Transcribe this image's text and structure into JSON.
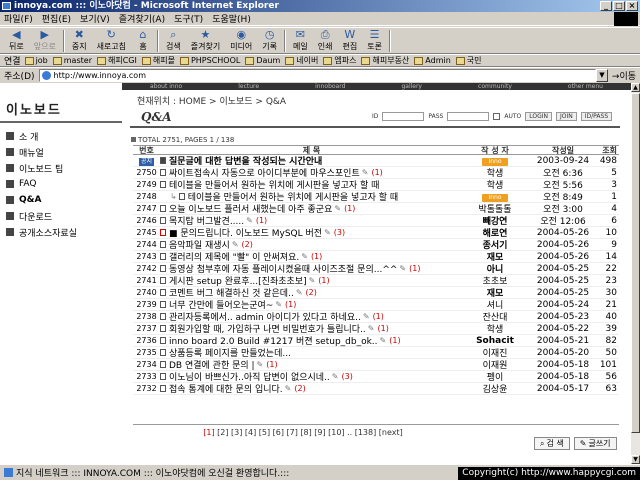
{
  "window": {
    "title": "innoya.com ::: 이노야닷컴 - Microsoft Internet Explorer"
  },
  "menu": [
    "파일(F)",
    "편집(E)",
    "보기(V)",
    "즐겨찾기(A)",
    "도구(T)",
    "도움말(H)"
  ],
  "toolbar": [
    {
      "label": "뒤로",
      "icon": "back-arrow-icon",
      "glyph": "◀"
    },
    {
      "label": "앞으로",
      "icon": "forward-arrow-icon",
      "glyph": "▶",
      "disabled": true
    },
    {
      "label": "중지",
      "icon": "stop-icon",
      "glyph": "✖"
    },
    {
      "label": "새로고침",
      "icon": "refresh-icon",
      "glyph": "↻"
    },
    {
      "label": "홈",
      "icon": "home-icon",
      "glyph": "⌂"
    },
    {
      "label": "검색",
      "icon": "search-icon",
      "glyph": "⌕"
    },
    {
      "label": "즐겨찾기",
      "icon": "favorites-icon",
      "glyph": "★"
    },
    {
      "label": "미디어",
      "icon": "media-icon",
      "glyph": "◉"
    },
    {
      "label": "기록",
      "icon": "history-icon",
      "glyph": "◷"
    },
    {
      "label": "메일",
      "icon": "mail-icon",
      "glyph": "✉"
    },
    {
      "label": "인쇄",
      "icon": "print-icon",
      "glyph": "⎙"
    },
    {
      "label": "편집",
      "icon": "edit-icon",
      "glyph": "W"
    },
    {
      "label": "토론",
      "icon": "discuss-icon",
      "glyph": "☰"
    }
  ],
  "links": {
    "label": "연결",
    "items": [
      "job",
      "master",
      "해피CGI",
      "해피몰",
      "PHPSCHOOL",
      "Daum",
      "네이버",
      "엠파스",
      "해피부동산",
      "Admin",
      "국민"
    ]
  },
  "address": {
    "label": "주소(D)",
    "url": "http://www.innoya.com",
    "go_label": "이동"
  },
  "sidebar": {
    "brand": "이노보드",
    "items": [
      "소 개",
      "매뉴얼",
      "이노보드 팁",
      "FAQ",
      "Q&A",
      "다운로드",
      "공개소스자료실"
    ],
    "active_index": 4
  },
  "topnav": [
    "about inno",
    "lecture",
    "innoboard",
    "gallery",
    "community",
    "other menu"
  ],
  "breadcrumb": "현재위치 : HOME > 이노보드 > Q&A",
  "page_title": "Q&A",
  "login": {
    "id_label": "ID",
    "pass_label": "PASS",
    "auto_label": "AUTO",
    "login_btn": "LOGIN",
    "join_btn": "JOIN",
    "idpass_btn": "ID/PASS"
  },
  "totals": "TOTAL 2751, PAGES 1 / 138",
  "columns": {
    "num": "번호",
    "title": "제 목",
    "author": "작 성 자",
    "date": "작성일",
    "hits": "조회"
  },
  "rows": [
    {
      "num": "",
      "notice": "공지",
      "title": "질문글에 대한 답변을 작성되는 시간안내",
      "comments": "",
      "author": "",
      "author_badge": "Inno",
      "date": "2003-09-24",
      "hits": "498",
      "bold": true
    },
    {
      "num": "2750",
      "title": "싸이트접속시 자동으로 아이디부분에 마우스포인트",
      "comments": "(1)",
      "author": "학생",
      "date": "오전 6:36",
      "hits": "5"
    },
    {
      "num": "2749",
      "title": "테이블을 만들어서 원하는 위치에 게시판을 넣고자 할 때",
      "comments": "",
      "author": "학생",
      "date": "오전 5:56",
      "hits": "3"
    },
    {
      "num": "2748",
      "reply": true,
      "title": "테이블을 만들어서 원하는 위치에 게시판을 넣고자 할 때",
      "comments": "",
      "author": "",
      "author_badge": "Inno",
      "date": "오전 8:49",
      "hits": "1"
    },
    {
      "num": "2747",
      "title": "오늘 이노보드 플러서 새했는데 아주 좋군요",
      "comments": "(1)",
      "author": "박톨톨톨",
      "date": "오전 3:00",
      "hits": "4"
    },
    {
      "num": "2746",
      "title": "목지탑 버그발견.....",
      "comments": "(1)",
      "author": "빼강연",
      "date": "오전 12:06",
      "hits": "6",
      "author_bold": true
    },
    {
      "num": "2745",
      "red": true,
      "title": "■ 문의드립니다. 이노보드 MySQL 버전",
      "comments": "(3)",
      "author": "해로연",
      "date": "2004-05-26",
      "hits": "10",
      "author_bold": true
    },
    {
      "num": "2744",
      "title": "음악파일 재생시",
      "comments": "(2)",
      "author": "종서기",
      "date": "2004-05-26",
      "hits": "9",
      "author_bold": true
    },
    {
      "num": "2743",
      "title": "갤러리의 제목에 \"빨\" 이 안써져요.",
      "comments": "(1)",
      "author": "재모",
      "date": "2004-05-26",
      "hits": "14",
      "author_bold": true
    },
    {
      "num": "2742",
      "title": "동영상 첨부후에 자동 플레이시켰을때 사이즈조절 문의...^^",
      "comments": "(1)",
      "author": "아니",
      "date": "2004-05-25",
      "hits": "22",
      "author_bold": true
    },
    {
      "num": "2741",
      "title": "게시판 setup 완료후...[진좌초초보]",
      "comments": "(1)",
      "author": "초초보",
      "date": "2004-05-25",
      "hits": "23"
    },
    {
      "num": "2740",
      "title": "코멘트 버그 해결하신 것 같은데..",
      "comments": "(2)",
      "author": "재모",
      "date": "2004-05-25",
      "hits": "30",
      "author_bold": true
    },
    {
      "num": "2739",
      "title": "너무 간만에 들어오는군여~",
      "comments": "(1)",
      "author": "셔니",
      "date": "2004-05-24",
      "hits": "21"
    },
    {
      "num": "2738",
      "title": "관리자등록에서.. admin 아이디가 있다고 하네요..",
      "comments": "(1)",
      "author": "잔산대",
      "date": "2004-05-23",
      "hits": "40"
    },
    {
      "num": "2737",
      "title": "회원가입할 때, 가입하구 나면 비밀번호가 틀립니다..",
      "comments": "(1)",
      "author": "학생",
      "date": "2004-05-22",
      "hits": "39"
    },
    {
      "num": "2736",
      "title": "inno board 2.0 Build #1217 버젼 setup_db_ok..",
      "comments": "(1)",
      "author": "Sohacit",
      "date": "2004-05-21",
      "hits": "82",
      "author_bold": true
    },
    {
      "num": "2735",
      "title": "상품등록 페이지를 만들었는데...",
      "comments": "",
      "author": "이재진",
      "date": "2004-05-20",
      "hits": "50"
    },
    {
      "num": "2734",
      "title": "DB 연결에 관한 문의 |",
      "comments": "(1)",
      "author": "이재원",
      "date": "2004-05-18",
      "hits": "101"
    },
    {
      "num": "2733",
      "title": "이노님이 바쁘신가..아직 답변이 없으시네..",
      "comments": "(3)",
      "author": "펭이",
      "date": "2004-05-18",
      "hits": "56"
    },
    {
      "num": "2732",
      "title": "접속 통계에 대한 문의 입니다.",
      "comments": "(2)",
      "author": "김상윤",
      "date": "2004-05-17",
      "hits": "63"
    }
  ],
  "pager": {
    "current": "[1]",
    "pages": "[2] [3] [4] [5] [6] [7] [8] [9] [10] .. [138] [next]"
  },
  "buttons": {
    "search": "검 색",
    "write": "글쓰기"
  },
  "status": {
    "text": "지식 네트워크 ::: INNOYA.COM ::: 이노야닷컴에 오신걸 환영합니다.:::"
  },
  "copyright": "Copyright(c) http://www.happycgi.com"
}
